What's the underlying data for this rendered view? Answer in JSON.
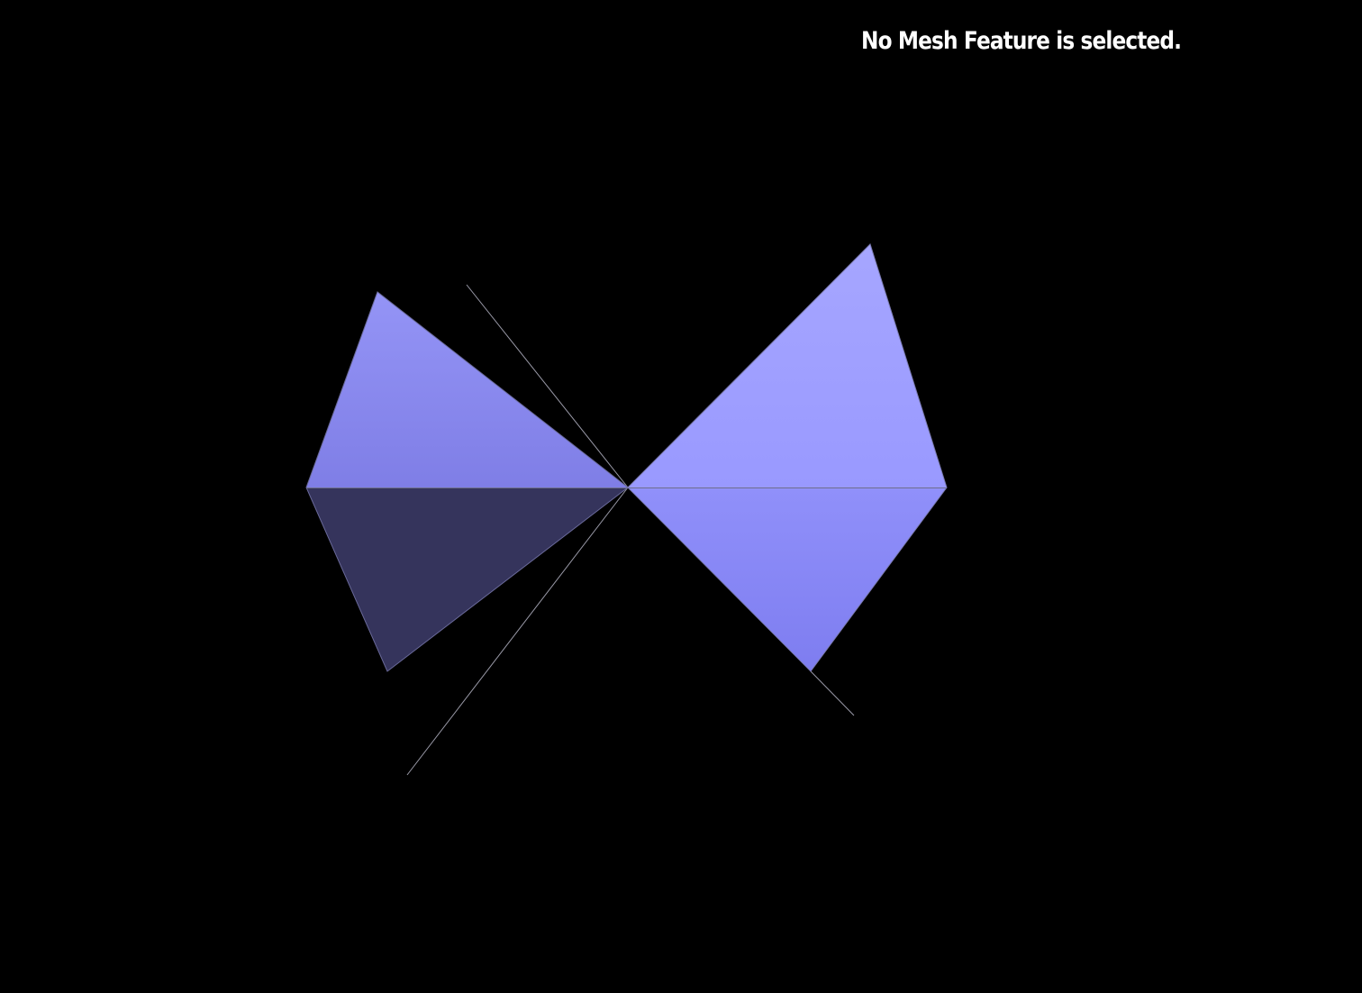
{
  "status": {
    "message": "No Mesh Feature is selected."
  },
  "colors": {
    "background": "#000000",
    "text": "#ffffff",
    "face_upper_left": "#8585e8",
    "face_lower_left": "#35345c",
    "face_upper_right": "#9d9cff",
    "face_lower_right": "#8b8af5",
    "edge_line": "#8a8a9a"
  },
  "scene": {
    "type": "3d-mesh-viewport",
    "faces": 4,
    "selection": "none"
  }
}
